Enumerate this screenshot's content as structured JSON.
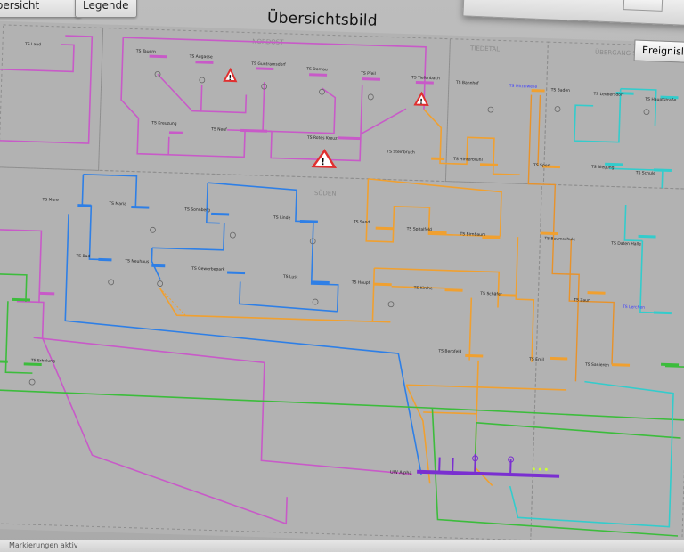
{
  "tabs": [
    {
      "label": "Übersicht"
    },
    {
      "label": "Legende"
    }
  ],
  "title": "Übersichtsbild",
  "events_tab": "Ereignisliste",
  "colors": {
    "magenta": "#c85ac8",
    "blue": "#2e7fe6",
    "orange": "#f0a030",
    "green": "#3cbc3c",
    "cyan": "#33cccc",
    "purple": "#7a2fd0",
    "warning": "#e03030"
  },
  "stations": {
    "tauern": "TS Tauern",
    "augasse": "TS Augasse",
    "guntramsdorf": "TS Guntramsdorf",
    "dornau": "TS Dornau",
    "pfeil": "TS Pfeil",
    "tiefenbach": "TS Tiefenbach",
    "bahnhof": "TS Bahnhof",
    "mittelwelle": "TS Mittelwelle",
    "baden": "TS Baden",
    "leobersdorf": "TS Leobersdorf",
    "hauptstr": "TS Hauptstraße",
    "kreuzung": "TS Kreuzung",
    "neuf": "TS Neuf",
    "rotes_kreuz": "TS Rotes Kreuz",
    "steinbruch": "TS Steinbruch",
    "hinterbruehl": "TS Hinterbrühl",
    "sport": "TS Sport",
    "biegung": "TS Biegung",
    "schule": "TS Schule",
    "mure": "TS Mure",
    "maria": "TS Maria",
    "sonnberg": "TS Sonnberg",
    "linde": "TS Linde",
    "sand": "TS Sand",
    "spitalfeld": "TS Spitalfeld",
    "birnbaum": "TS Birnbaum",
    "baumschule": "TS Baumschule",
    "daten_halle": "TS Daten Halle",
    "bad": "TS Bad",
    "neuhaus": "TS Neuhaus",
    "gewerbepark": "TS Gewerbepark",
    "lust": "TS Lust",
    "haupt_left": "TS Haupt",
    "kirche": "TS Kirche",
    "schaefer": "TS Schäfer",
    "zaun": "TS Zaun",
    "lerchen": "TS Lerchen",
    "bergfeld": "TS Bergfeld",
    "emil": "TS Emil",
    "sanieren": "TS Sanieren",
    "erholung": "TS Erholung",
    "land": "TS Land",
    "uw": "UW Alpha"
  },
  "areas": {
    "region_north": "NORDOST",
    "region_center": "TIEDETAL",
    "region_east": "ÜBERGANG SONNBERG",
    "region_west": "SÜDEN"
  },
  "warnings": [
    "!",
    "!",
    "!",
    "!"
  ],
  "status_text": "Markierungen aktiv"
}
